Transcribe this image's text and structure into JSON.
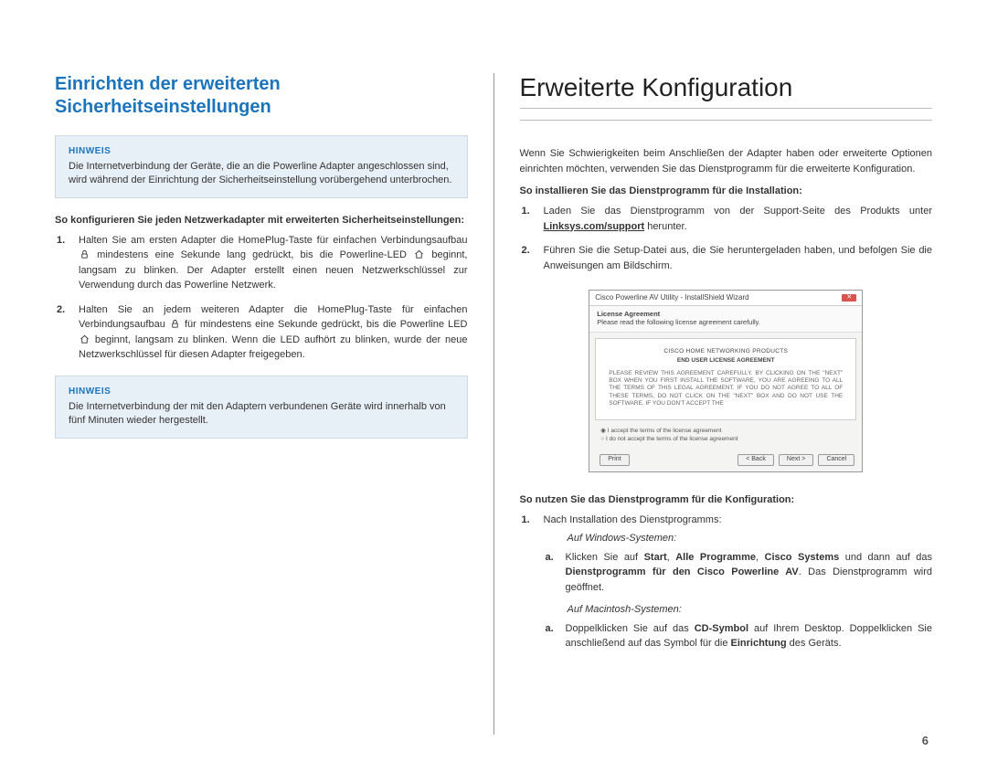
{
  "left": {
    "heading": "Einrichten der erweiterten Sicherheitseinstellungen",
    "note1": {
      "title": "HINWEIS",
      "body": "Die Internetverbindung der Geräte, die an die Powerline Adapter angeschlossen sind, wird während der Einrichtung der Sicherheitseinstellung vorübergehend unterbrochen."
    },
    "lead": "So konfigurieren Sie jeden Netzwerkadapter mit erweiterten Sicherheitseinstellungen:",
    "step1_a": "Halten Sie am ersten Adapter die HomePlug-Taste für einfachen Verbindungsaufbau ",
    "step1_b": " mindestens eine Sekunde lang gedrückt, bis die Powerline-LED ",
    "step1_c": " beginnt, langsam zu blinken. Der Adapter erstellt einen neuen Netzwerkschlüssel zur Verwendung durch das Powerline Netzwerk.",
    "step2_a": "Halten Sie an jedem weiteren Adapter die HomePlug-Taste für einfachen Verbindungsaufbau ",
    "step2_b": " für mindestens eine Sekunde gedrückt, bis die Powerline LED ",
    "step2_c": " beginnt, langsam zu blinken. Wenn die LED aufhört zu blinken, wurde der neue Netzwerkschlüssel für diesen Adapter freigegeben.",
    "note2": {
      "title": "HINWEIS",
      "body": "Die Internetverbindung der mit den Adaptern verbundenen Geräte wird innerhalb von fünf Minuten wieder hergestellt."
    }
  },
  "right": {
    "heading": "Erweiterte Konfiguration",
    "intro": "Wenn Sie Schwierigkeiten beim Anschließen der Adapter haben oder erweiterte Optionen einrichten möchten, verwenden Sie das Dienstprogramm für die erweiterte Konfiguration.",
    "install_lead": "So installieren Sie das Dienstprogramm für die Installation:",
    "install_step1_a": "Laden Sie das Dienstprogramm von der Support-Seite des Produkts unter ",
    "install_link": "Linksys.com/support",
    "install_step1_b": " herunter.",
    "install_step2": "Führen Sie die Setup-Datei aus, die Sie heruntergeladen haben, und befolgen Sie die Anweisungen am Bildschirm.",
    "screenshot": {
      "title": "Cisco Powerline AV Utility - InstallShield Wizard",
      "sub_title": "License Agreement",
      "sub_desc": "Please read the following license agreement carefully.",
      "eula_h1": "CISCO HOME NETWORKING PRODUCTS",
      "eula_h2": "END USER LICENSE AGREEMENT",
      "eula_body": "PLEASE REVIEW THIS AGREEMENT CAREFULLY. BY CLICKING ON THE \"NEXT\" BOX WHEN YOU FIRST INSTALL THE SOFTWARE, YOU ARE AGREEING TO ALL THE TERMS OF THIS LEGAL AGREEMENT. IF YOU DO NOT AGREE TO ALL OF THESE TERMS, DO NOT CLICK ON THE \"NEXT\" BOX AND DO NOT USE THE SOFTWARE. IF YOU DON'T ACCEPT THE",
      "radio1": "I accept the terms of the license agreement",
      "radio2": "I do not accept the terms of the license agreement",
      "btn_print": "Print",
      "btn_back": "< Back",
      "btn_next": "Next >",
      "btn_cancel": "Cancel"
    },
    "use_lead": "So nutzen Sie das Dienstprogramm für die Konfiguration:",
    "use_step1": "Nach Installation des Dienstprogramms:",
    "win_label": "Auf Windows-Systemen:",
    "win_a_pre": "Klicken Sie auf ",
    "win_a_b1": "Start",
    "win_a_mid1": ", ",
    "win_a_b2": "Alle Programme",
    "win_a_mid2": ", ",
    "win_a_b3": "Cisco Systems",
    "win_a_mid3": " und dann auf das ",
    "win_a_b4": "Dienstprogramm für den Cisco Powerline AV",
    "win_a_post": ". Das Dienstprogramm wird geöffnet.",
    "mac_label": "Auf Macintosh-Systemen:",
    "mac_a_pre": "Doppelklicken Sie auf das ",
    "mac_a_b1": "CD-Symbol",
    "mac_a_mid": " auf Ihrem Desktop. Doppelklicken Sie anschließend auf das Symbol für die ",
    "mac_a_b2": "Einrichtung",
    "mac_a_post": " des Geräts."
  },
  "pagenum": "6"
}
